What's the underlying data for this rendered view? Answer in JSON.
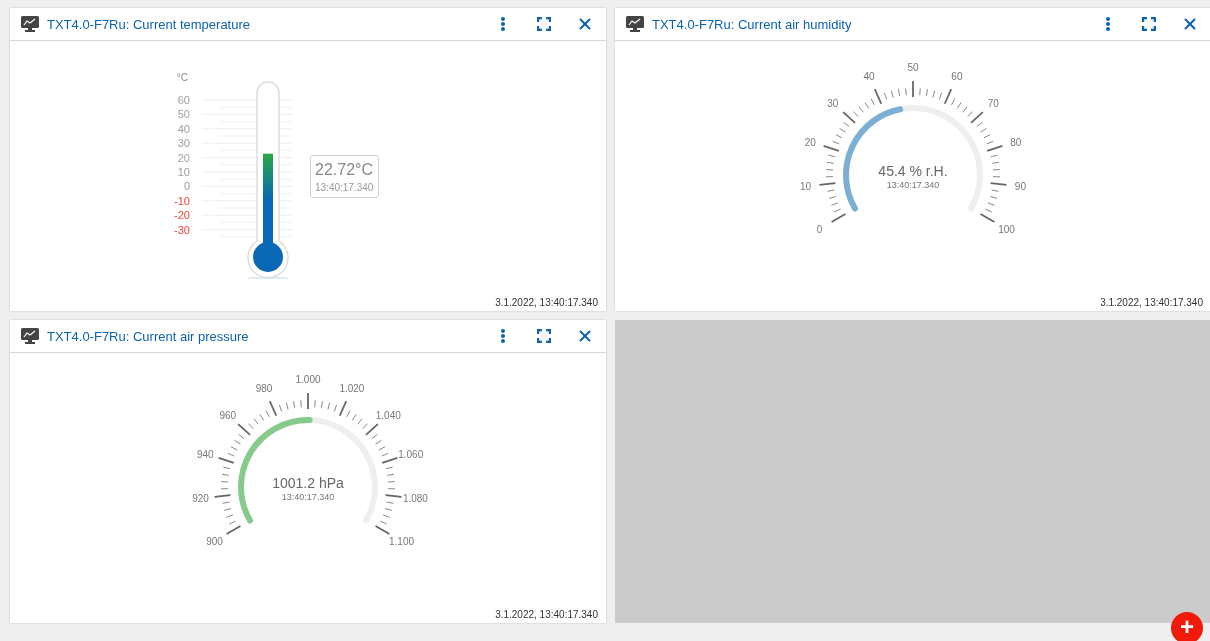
{
  "panels": [
    {
      "kind": "thermometer",
      "title": "TXT4.0-F7Ru: Current temperature",
      "unit": "°C",
      "scale": [
        {
          "label": "60",
          "negative": false
        },
        {
          "label": "50",
          "negative": false
        },
        {
          "label": "40",
          "negative": false
        },
        {
          "label": "30",
          "negative": false
        },
        {
          "label": "20",
          "negative": false
        },
        {
          "label": "10",
          "negative": false
        },
        {
          "label": "0",
          "negative": false
        },
        {
          "label": "-10",
          "negative": true
        },
        {
          "label": "-20",
          "negative": true
        },
        {
          "label": "-30",
          "negative": true
        }
      ],
      "value": "22.72°C",
      "time": "13:40:17.340",
      "footer": "3.1.2022, 13:40:17.340"
    },
    {
      "kind": "gauge",
      "title": "TXT4.0-F7Ru: Current air humidity",
      "scale": [
        "0",
        "10",
        "20",
        "30",
        "40",
        "50",
        "60",
        "70",
        "80",
        "90",
        "100"
      ],
      "color": "#7bafd4",
      "value": "45.4 % r.H.",
      "time": "13:40:17.340",
      "footer": "3.1.2022, 13:40:17.340"
    },
    {
      "kind": "gauge",
      "title": "TXT4.0-F7Ru: Current air pressure",
      "scale": [
        "900",
        "920",
        "940",
        "960",
        "980",
        "1.000",
        "1.020",
        "1.040",
        "1.060",
        "1.080",
        "1.100"
      ],
      "color": "#86cb8c",
      "value": "1001.2 hPa",
      "time": "13:40:17.340",
      "footer": "3.1.2022, 13:40:17.340"
    },
    {
      "kind": "empty"
    }
  ],
  "add_button": {
    "label": "+"
  }
}
